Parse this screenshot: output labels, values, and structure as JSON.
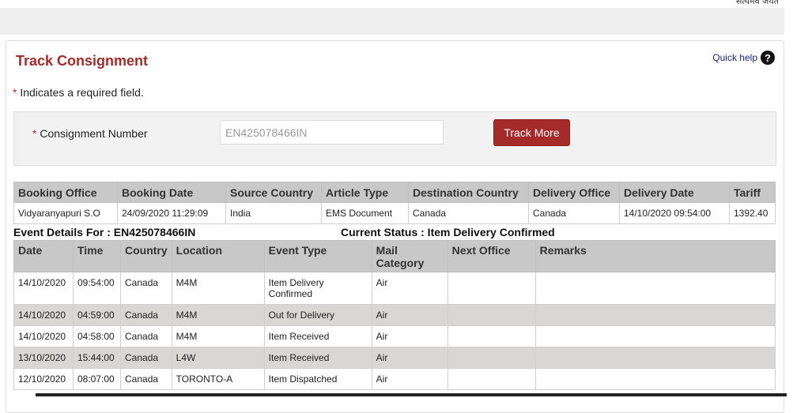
{
  "header": {
    "motto": "सत्यमेव जयते"
  },
  "panel": {
    "title": "Track Consignment",
    "quick_help": "Quick help",
    "quick_help_icon": "?",
    "required_star": "*",
    "required_note": " Indicates a required field."
  },
  "form": {
    "label": "Consignment Number",
    "value": "EN425078466IN",
    "button": "Track More"
  },
  "booking": {
    "headers": [
      "Booking Office",
      "Booking Date",
      "Source Country",
      "Article Type",
      "Destination Country",
      "Delivery Office",
      "Delivery Date",
      "Tariff"
    ],
    "row": [
      "Vidyaranyapuri S.O",
      "24/09/2020 11:29:09",
      "India",
      "EMS Document",
      "Canada",
      "Canada",
      "14/10/2020 09:54:00",
      "1392.40"
    ]
  },
  "events_info": {
    "heading": "Event Details For : EN425078466IN",
    "status": "Current Status : Item Delivery Confirmed"
  },
  "events": {
    "headers": [
      "Date",
      "Time",
      "Country",
      "Location",
      "Event Type",
      "Mail Category",
      "Next Office",
      "Remarks"
    ],
    "rows": [
      [
        "14/10/2020",
        "09:54:00",
        "Canada",
        "M4M",
        "Item Delivery Confirmed",
        "Air",
        "",
        ""
      ],
      [
        "14/10/2020",
        "04:59:00",
        "Canada",
        "M4M",
        "Out for Delivery",
        "Air",
        "",
        ""
      ],
      [
        "14/10/2020",
        "04:58:00",
        "Canada",
        "M4M",
        "Item Received",
        "Air",
        "",
        ""
      ],
      [
        "13/10/2020",
        "15:44:00",
        "Canada",
        "L4W",
        "Item Received",
        "Air",
        "",
        ""
      ],
      [
        "12/10/2020",
        "08:07:00",
        "Canada",
        "TORONTO-A",
        "Item Dispatched",
        "Air",
        "",
        ""
      ]
    ]
  },
  "colors": {
    "accent": "#a52a2a",
    "header_bg": "#c8c8c8",
    "alt_row": "#d9d6d6"
  }
}
